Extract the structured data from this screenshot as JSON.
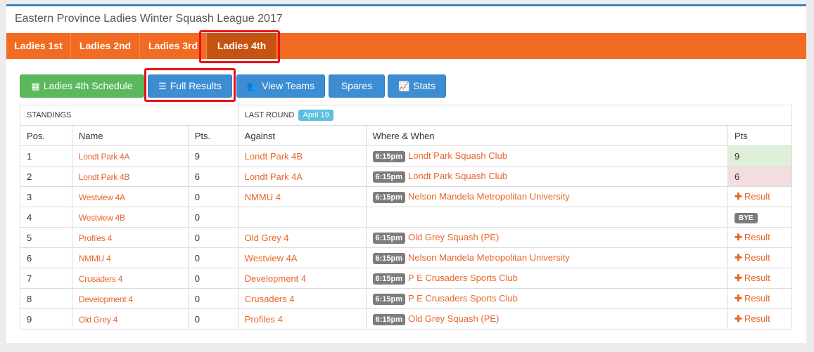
{
  "title": "Eastern Province Ladies Winter Squash League 2017",
  "tabs": [
    {
      "label": "Ladies 1st"
    },
    {
      "label": "Ladies 2nd"
    },
    {
      "label": "Ladies 3rd"
    },
    {
      "label": "Ladies 4th"
    }
  ],
  "buttons": {
    "schedule": "Ladies 4th Schedule",
    "full_results": "Full Results",
    "view_teams": "View Teams",
    "spares": "Spares",
    "stats": "Stats"
  },
  "standings_label": "STANDINGS",
  "last_round_label": "LAST ROUND",
  "last_round_date": "April 19",
  "columns": {
    "pos": "Pos.",
    "name": "Name",
    "pts": "Pts.",
    "against": "Against",
    "where": "Where & When",
    "pts2": "Pts"
  },
  "result_label": "Result",
  "bye_label": "BYE",
  "rows": [
    {
      "pos": "1",
      "name": "Londt Park 4A",
      "pts": "9",
      "against": "Londt Park 4B",
      "time": "6:15pm",
      "venue": "Londt Park Squash Club",
      "score": "9"
    },
    {
      "pos": "2",
      "name": "Londt Park 4B",
      "pts": "6",
      "against": "Londt Park 4A",
      "time": "6:15pm",
      "venue": "Londt Park Squash Club",
      "score": "6"
    },
    {
      "pos": "3",
      "name": "Westview 4A",
      "pts": "0",
      "against": "NMMU 4",
      "time": "6:15pm",
      "venue": "Nelson Mandela Metropolitan University",
      "score": ""
    },
    {
      "pos": "4",
      "name": "Westview 4B",
      "pts": "0",
      "against": "",
      "time": "",
      "venue": "",
      "score": ""
    },
    {
      "pos": "5",
      "name": "Profiles 4",
      "pts": "0",
      "against": "Old Grey 4",
      "time": "6:15pm",
      "venue": "Old Grey Squash (PE)",
      "score": ""
    },
    {
      "pos": "6",
      "name": "NMMU 4",
      "pts": "0",
      "against": "Westview 4A",
      "time": "6:15pm",
      "venue": "Nelson Mandela Metropolitan University",
      "score": ""
    },
    {
      "pos": "7",
      "name": "Crusaders 4",
      "pts": "0",
      "against": "Development 4",
      "time": "6:15pm",
      "venue": "P E Crusaders Sports Club",
      "score": ""
    },
    {
      "pos": "8",
      "name": "Development 4",
      "pts": "0",
      "against": "Crusaders 4",
      "time": "6:15pm",
      "venue": "P E Crusaders Sports Club",
      "score": ""
    },
    {
      "pos": "9",
      "name": "Old Grey 4",
      "pts": "0",
      "against": "Profiles 4",
      "time": "6:15pm",
      "venue": "Old Grey Squash (PE)",
      "score": ""
    }
  ],
  "colors": {
    "tabbar": "#f26b22",
    "tab_active": "#c55412",
    "link": "#e8652a",
    "highlight": "#e8101a",
    "btn_green": "#5cb85c",
    "btn_blue": "#3d8dd3"
  }
}
